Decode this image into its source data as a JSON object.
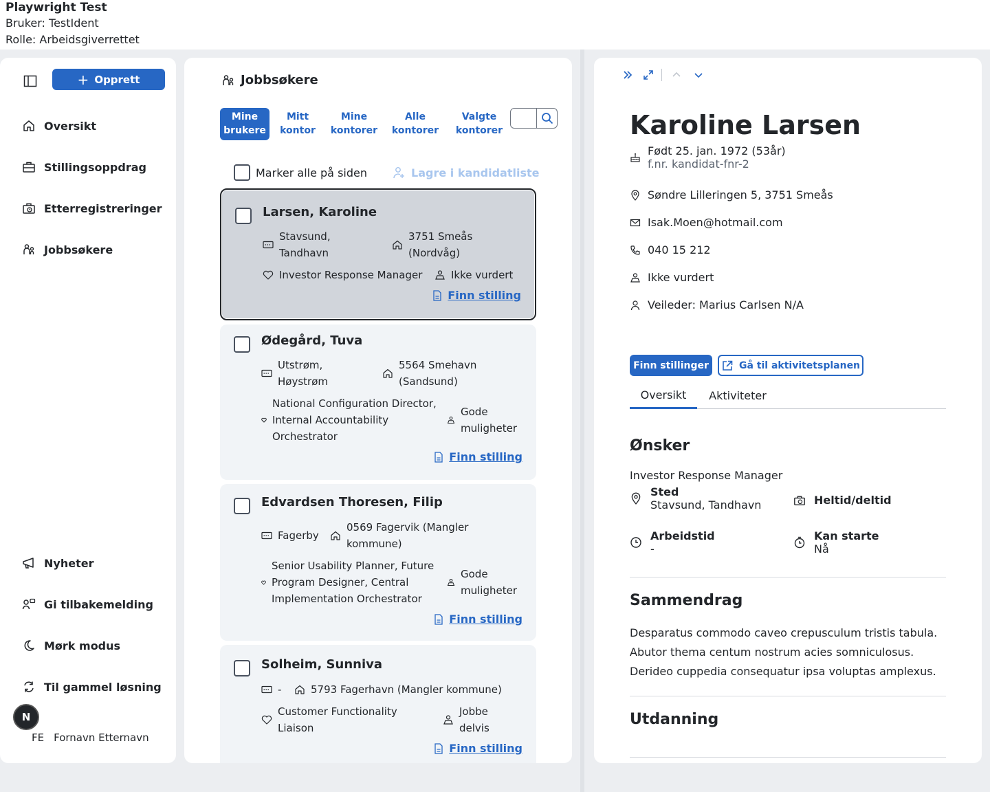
{
  "banner": {
    "title": "Playwright Test",
    "user": "Bruker: TestIdent",
    "role": "Rolle: Arbeidsgiverrettet"
  },
  "sidebar": {
    "create_label": "Opprett",
    "items": [
      {
        "label": "Oversikt",
        "icon": "house-icon"
      },
      {
        "label": "Stillingsoppdrag",
        "icon": "briefcase-icon"
      },
      {
        "label": "Etterregistreringer",
        "icon": "briefcase-clock-icon"
      },
      {
        "label": "Jobbsøkere",
        "icon": "people-icon"
      }
    ],
    "bottom_items": [
      {
        "label": "Nyheter",
        "icon": "megaphone-icon"
      },
      {
        "label": "Gi tilbakemelding",
        "icon": "feedback-icon"
      },
      {
        "label": "Mørk modus",
        "icon": "moon-icon"
      },
      {
        "label": "Til gammel løsning",
        "icon": "arrows-circle-icon"
      }
    ],
    "avatar_letter": "N",
    "user_initials": "FE",
    "user_name": "Fornavn Etternavn"
  },
  "middle": {
    "title": "Jobbsøkere",
    "filters": [
      {
        "line1": "Mine",
        "line2": "brukere"
      },
      {
        "line1": "Mitt",
        "line2": "kontor"
      },
      {
        "line1": "Mine",
        "line2": "kontorer"
      },
      {
        "line1": "Alle",
        "line2": "kontorer"
      },
      {
        "line1": "Valgte",
        "line2": "kontorer"
      }
    ],
    "mark_all": "Marker alle på siden",
    "save_list": "Lagre i kandidatliste",
    "link_label": "Finn stilling",
    "candidates": [
      {
        "name": "Larsen, Karoline",
        "place_l1": "Stavsund,",
        "place_l2": "Tandhavn",
        "addr_l1": "3751 Smeås",
        "addr_l2": "(Nordvåg)",
        "job_l1": "Investor Response Manager",
        "job_l2": "",
        "job_l3": "",
        "status_l1": "Ikke vurdert",
        "status_l2": ""
      },
      {
        "name": "Ødegård, Tuva",
        "place_l1": "Utstrøm,",
        "place_l2": "Høystrøm",
        "addr_l1": "5564 Smehavn",
        "addr_l2": "(Sandsund)",
        "job_l1": "National Configuration Director,",
        "job_l2": "Internal Accountability",
        "job_l3": "Orchestrator",
        "status_l1": "Gode",
        "status_l2": "muligheter"
      },
      {
        "name": "Edvardsen Thoresen, Filip",
        "place_l1": "Fagerby",
        "place_l2": "",
        "addr_l1": "0569 Fagervik (Mangler",
        "addr_l2": "kommune)",
        "job_l1": "Senior Usability Planner, Future",
        "job_l2": "Program Designer, Central",
        "job_l3": "Implementation Orchestrator",
        "status_l1": "Gode",
        "status_l2": "muligheter"
      },
      {
        "name": "Solheim, Sunniva",
        "place_l1": "-",
        "place_l2": "",
        "addr_l1": "5793 Fagerhavn (Mangler kommune)",
        "addr_l2": "",
        "job_l1": "Customer Functionality",
        "job_l2": "Liaison",
        "job_l3": "",
        "status_l1": "Jobbe",
        "status_l2": "delvis"
      }
    ]
  },
  "detail": {
    "name": "Karoline Larsen",
    "birth": "Født 25. jan. 1972 (53år)",
    "fnr": "f.nr. kandidat-fnr-2",
    "address": "Søndre Lilleringen 5, 3751 Smeås",
    "email": "Isak.Moen@hotmail.com",
    "phone": "040 15 212",
    "status": "Ikke vurdert",
    "advisor": "Veileder: Marius Carlsen N/A",
    "btn_find": "Finn stillinger",
    "btn_plan": "Gå til aktivitetsplanen",
    "tabs": [
      "Oversikt",
      "Aktiviteter"
    ],
    "wishes_title": "Ønsker",
    "wish_job": "Investor Response Manager",
    "place_label": "Sted",
    "place_value": "Stavsund, Tandhavn",
    "fulltime_label": "Heltid/deltid",
    "worktime_label": "Arbeidstid",
    "worktime_value": "-",
    "start_label": "Kan starte",
    "start_value": "Nå",
    "summary_title": "Sammendrag",
    "summary_text": "Desparatus commodo caveo crepusculum tristis tabula. Abutor thema centum nostrum acies somniculosus. Derideo cuppedia consequatur ipsa voluptas amplexus.",
    "education_title": "Utdanning"
  },
  "colors": {
    "accent": "#2767c4",
    "text": "#23262a",
    "card_bg": "#f1f4f7",
    "selected_card": "#d1d5db"
  }
}
